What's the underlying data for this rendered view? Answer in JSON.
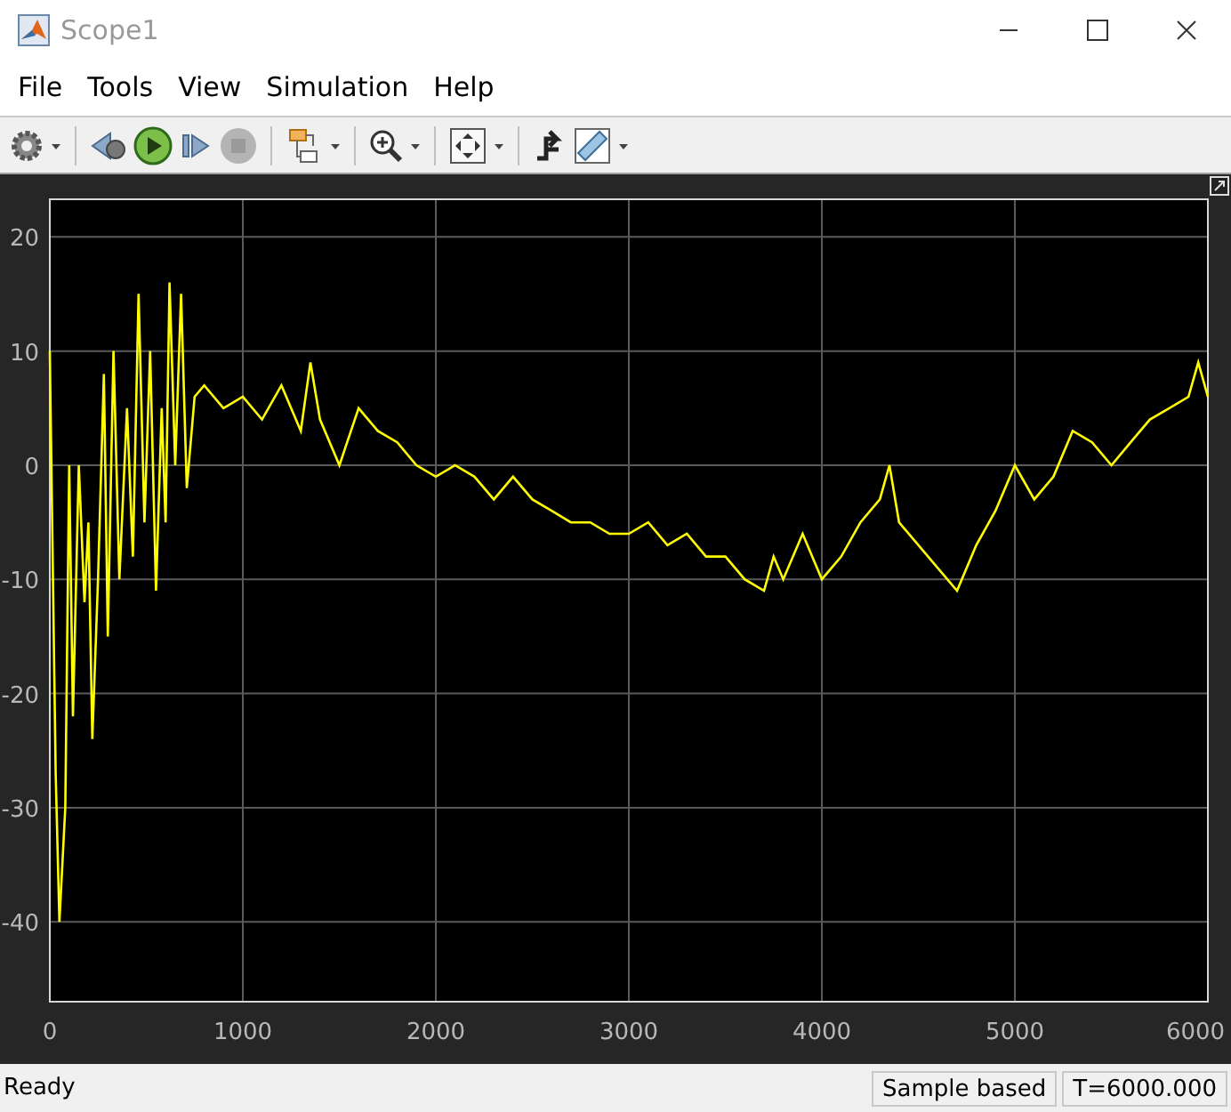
{
  "window": {
    "title": "Scope1"
  },
  "menu": [
    {
      "label": "File"
    },
    {
      "label": "Tools"
    },
    {
      "label": "View"
    },
    {
      "label": "Simulation"
    },
    {
      "label": "Help"
    }
  ],
  "plot": {
    "chart_data": {
      "type": "line",
      "grid": true,
      "xlim": [
        0,
        6000
      ],
      "ylim": [
        -47,
        23.3
      ],
      "xticks": [
        0,
        1000,
        2000,
        3000,
        4000,
        5000,
        6000
      ],
      "yticks": [
        20,
        10,
        0,
        -10,
        -20,
        -30,
        -40
      ],
      "x": [
        0,
        30,
        50,
        80,
        100,
        120,
        150,
        180,
        200,
        220,
        250,
        280,
        300,
        330,
        360,
        400,
        430,
        460,
        490,
        520,
        550,
        580,
        600,
        620,
        650,
        680,
        710,
        750,
        800,
        900,
        1000,
        1100,
        1200,
        1300,
        1350,
        1400,
        1500,
        1600,
        1700,
        1800,
        1900,
        2000,
        2100,
        2200,
        2300,
        2400,
        2500,
        2600,
        2700,
        2800,
        2900,
        3000,
        3100,
        3200,
        3300,
        3400,
        3500,
        3600,
        3700,
        3750,
        3800,
        3900,
        4000,
        4100,
        4200,
        4300,
        4350,
        4400,
        4500,
        4600,
        4700,
        4800,
        4900,
        5000,
        5100,
        5200,
        5300,
        5400,
        5500,
        5600,
        5700,
        5800,
        5900,
        5950,
        6000
      ],
      "series": [
        {
          "color": "#ffff00",
          "values": [
            10,
            -27,
            -40,
            -30,
            0,
            -22,
            0,
            -12,
            -5,
            -24,
            -10,
            8,
            -15,
            10,
            -10,
            5,
            -8,
            15,
            -5,
            10,
            -11,
            5,
            -5,
            16,
            0,
            15,
            -2,
            6,
            7,
            5,
            6,
            4,
            7,
            3,
            9,
            4,
            0,
            5,
            3,
            2,
            0,
            -1,
            0,
            -1,
            -3,
            -1,
            -3,
            -4,
            -5,
            -5,
            -6,
            -6,
            -5,
            -7,
            -6,
            -8,
            -8,
            -10,
            -11,
            -8,
            -10,
            -6,
            -10,
            -8,
            -5,
            -3,
            0,
            -5,
            -7,
            -9,
            -11,
            -7,
            -4,
            0,
            -3,
            -1,
            3,
            2,
            0,
            2,
            4,
            5,
            6,
            9,
            6
          ]
        }
      ]
    }
  },
  "status_bar": {
    "message": "Ready",
    "mode": "Sample based",
    "time": "T=6000.000"
  }
}
